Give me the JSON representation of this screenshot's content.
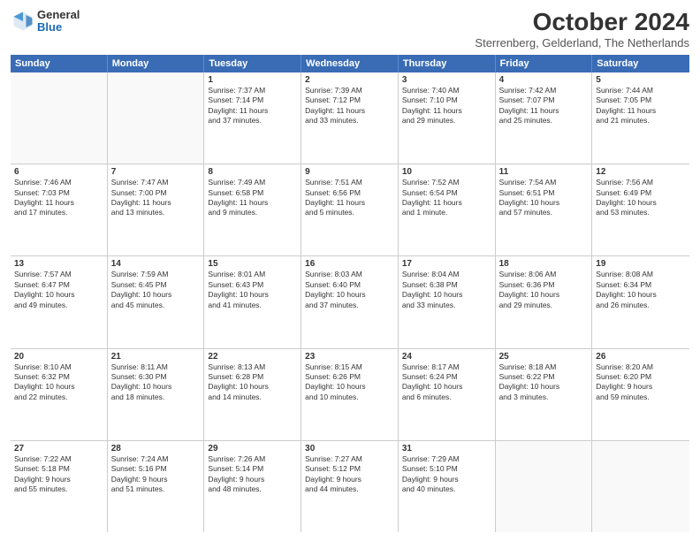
{
  "header": {
    "logo": {
      "general": "General",
      "blue": "Blue"
    },
    "title": "October 2024",
    "subtitle": "Sterrenberg, Gelderland, The Netherlands"
  },
  "days_of_week": [
    "Sunday",
    "Monday",
    "Tuesday",
    "Wednesday",
    "Thursday",
    "Friday",
    "Saturday"
  ],
  "weeks": [
    [
      {
        "day": "",
        "info": [],
        "empty": true
      },
      {
        "day": "",
        "info": [],
        "empty": true
      },
      {
        "day": "1",
        "info": [
          "Sunrise: 7:37 AM",
          "Sunset: 7:14 PM",
          "Daylight: 11 hours",
          "and 37 minutes."
        ]
      },
      {
        "day": "2",
        "info": [
          "Sunrise: 7:39 AM",
          "Sunset: 7:12 PM",
          "Daylight: 11 hours",
          "and 33 minutes."
        ]
      },
      {
        "day": "3",
        "info": [
          "Sunrise: 7:40 AM",
          "Sunset: 7:10 PM",
          "Daylight: 11 hours",
          "and 29 minutes."
        ]
      },
      {
        "day": "4",
        "info": [
          "Sunrise: 7:42 AM",
          "Sunset: 7:07 PM",
          "Daylight: 11 hours",
          "and 25 minutes."
        ]
      },
      {
        "day": "5",
        "info": [
          "Sunrise: 7:44 AM",
          "Sunset: 7:05 PM",
          "Daylight: 11 hours",
          "and 21 minutes."
        ]
      }
    ],
    [
      {
        "day": "6",
        "info": [
          "Sunrise: 7:46 AM",
          "Sunset: 7:03 PM",
          "Daylight: 11 hours",
          "and 17 minutes."
        ]
      },
      {
        "day": "7",
        "info": [
          "Sunrise: 7:47 AM",
          "Sunset: 7:00 PM",
          "Daylight: 11 hours",
          "and 13 minutes."
        ]
      },
      {
        "day": "8",
        "info": [
          "Sunrise: 7:49 AM",
          "Sunset: 6:58 PM",
          "Daylight: 11 hours",
          "and 9 minutes."
        ]
      },
      {
        "day": "9",
        "info": [
          "Sunrise: 7:51 AM",
          "Sunset: 6:56 PM",
          "Daylight: 11 hours",
          "and 5 minutes."
        ]
      },
      {
        "day": "10",
        "info": [
          "Sunrise: 7:52 AM",
          "Sunset: 6:54 PM",
          "Daylight: 11 hours",
          "and 1 minute."
        ]
      },
      {
        "day": "11",
        "info": [
          "Sunrise: 7:54 AM",
          "Sunset: 6:51 PM",
          "Daylight: 10 hours",
          "and 57 minutes."
        ]
      },
      {
        "day": "12",
        "info": [
          "Sunrise: 7:56 AM",
          "Sunset: 6:49 PM",
          "Daylight: 10 hours",
          "and 53 minutes."
        ]
      }
    ],
    [
      {
        "day": "13",
        "info": [
          "Sunrise: 7:57 AM",
          "Sunset: 6:47 PM",
          "Daylight: 10 hours",
          "and 49 minutes."
        ]
      },
      {
        "day": "14",
        "info": [
          "Sunrise: 7:59 AM",
          "Sunset: 6:45 PM",
          "Daylight: 10 hours",
          "and 45 minutes."
        ]
      },
      {
        "day": "15",
        "info": [
          "Sunrise: 8:01 AM",
          "Sunset: 6:43 PM",
          "Daylight: 10 hours",
          "and 41 minutes."
        ]
      },
      {
        "day": "16",
        "info": [
          "Sunrise: 8:03 AM",
          "Sunset: 6:40 PM",
          "Daylight: 10 hours",
          "and 37 minutes."
        ]
      },
      {
        "day": "17",
        "info": [
          "Sunrise: 8:04 AM",
          "Sunset: 6:38 PM",
          "Daylight: 10 hours",
          "and 33 minutes."
        ]
      },
      {
        "day": "18",
        "info": [
          "Sunrise: 8:06 AM",
          "Sunset: 6:36 PM",
          "Daylight: 10 hours",
          "and 29 minutes."
        ]
      },
      {
        "day": "19",
        "info": [
          "Sunrise: 8:08 AM",
          "Sunset: 6:34 PM",
          "Daylight: 10 hours",
          "and 26 minutes."
        ]
      }
    ],
    [
      {
        "day": "20",
        "info": [
          "Sunrise: 8:10 AM",
          "Sunset: 6:32 PM",
          "Daylight: 10 hours",
          "and 22 minutes."
        ]
      },
      {
        "day": "21",
        "info": [
          "Sunrise: 8:11 AM",
          "Sunset: 6:30 PM",
          "Daylight: 10 hours",
          "and 18 minutes."
        ]
      },
      {
        "day": "22",
        "info": [
          "Sunrise: 8:13 AM",
          "Sunset: 6:28 PM",
          "Daylight: 10 hours",
          "and 14 minutes."
        ]
      },
      {
        "day": "23",
        "info": [
          "Sunrise: 8:15 AM",
          "Sunset: 6:26 PM",
          "Daylight: 10 hours",
          "and 10 minutes."
        ]
      },
      {
        "day": "24",
        "info": [
          "Sunrise: 8:17 AM",
          "Sunset: 6:24 PM",
          "Daylight: 10 hours",
          "and 6 minutes."
        ]
      },
      {
        "day": "25",
        "info": [
          "Sunrise: 8:18 AM",
          "Sunset: 6:22 PM",
          "Daylight: 10 hours",
          "and 3 minutes."
        ]
      },
      {
        "day": "26",
        "info": [
          "Sunrise: 8:20 AM",
          "Sunset: 6:20 PM",
          "Daylight: 9 hours",
          "and 59 minutes."
        ]
      }
    ],
    [
      {
        "day": "27",
        "info": [
          "Sunrise: 7:22 AM",
          "Sunset: 5:18 PM",
          "Daylight: 9 hours",
          "and 55 minutes."
        ]
      },
      {
        "day": "28",
        "info": [
          "Sunrise: 7:24 AM",
          "Sunset: 5:16 PM",
          "Daylight: 9 hours",
          "and 51 minutes."
        ]
      },
      {
        "day": "29",
        "info": [
          "Sunrise: 7:26 AM",
          "Sunset: 5:14 PM",
          "Daylight: 9 hours",
          "and 48 minutes."
        ]
      },
      {
        "day": "30",
        "info": [
          "Sunrise: 7:27 AM",
          "Sunset: 5:12 PM",
          "Daylight: 9 hours",
          "and 44 minutes."
        ]
      },
      {
        "day": "31",
        "info": [
          "Sunrise: 7:29 AM",
          "Sunset: 5:10 PM",
          "Daylight: 9 hours",
          "and 40 minutes."
        ]
      },
      {
        "day": "",
        "info": [],
        "empty": true
      },
      {
        "day": "",
        "info": [],
        "empty": true
      }
    ]
  ]
}
